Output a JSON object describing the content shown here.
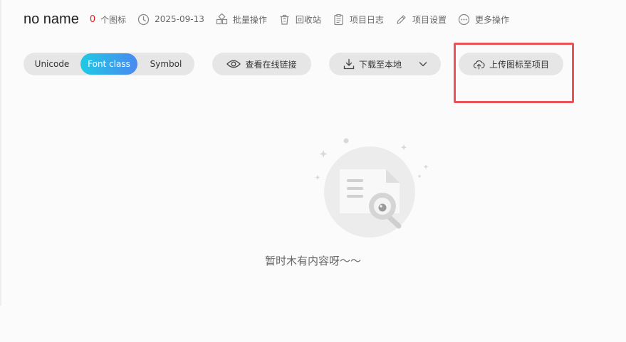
{
  "project": {
    "name": "no name",
    "icon_count": "0",
    "icon_count_label": "个图标",
    "date": "2025-09-13"
  },
  "header_actions": [
    {
      "label": "批量操作",
      "icon": "batch-icon"
    },
    {
      "label": "回收站",
      "icon": "trash-icon"
    },
    {
      "label": "项目日志",
      "icon": "clipboard-icon"
    },
    {
      "label": "项目设置",
      "icon": "pencil-icon"
    },
    {
      "label": "更多操作",
      "icon": "more-icon"
    }
  ],
  "format_tabs": {
    "items": [
      "Unicode",
      "Font class",
      "Symbol"
    ],
    "active": "Font class"
  },
  "toolbar": {
    "view_online": "查看在线链接",
    "download": "下载至本地",
    "upload": "上传图标至项目"
  },
  "empty_state": {
    "message": "暂时木有内容呀～～"
  },
  "colors": {
    "accent_gradient_start": "#1fc9e4",
    "accent_gradient_end": "#4a89f0",
    "count_red": "#e02020",
    "highlight_red": "#eb5255"
  }
}
